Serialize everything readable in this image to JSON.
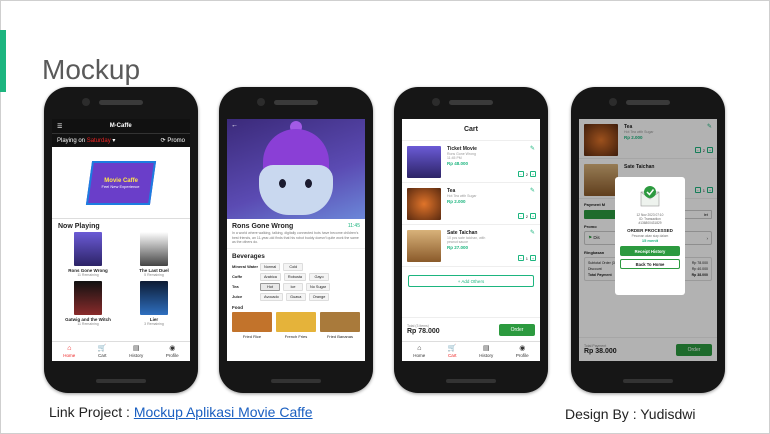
{
  "slide": {
    "title": "Mockup",
    "link_prefix": "Link Project :",
    "link_text": "Mockup Aplikasi Movie Caffe",
    "designer": "Design By : Yudisdwi",
    "accent_color": "#1db57f"
  },
  "home_screen": {
    "app_title": "M-Caffe",
    "playing_on": "Playing on",
    "day": "Saturday",
    "promo": "Promo",
    "banner_title": "Movie Caffe",
    "banner_subtitle": "Feel New Experience",
    "section_title": "Now Playing",
    "movies": [
      {
        "name": "Rons Gone Wrong",
        "remaining": "11 Remaining",
        "color": "#4b3f9a"
      },
      {
        "name": "The Last Duel",
        "remaining": "5 Remaining",
        "color": "#3b3b3b"
      },
      {
        "name": "Gatwig and the Witch",
        "remaining": "11 Remaining",
        "color": "#6b2a2a"
      },
      {
        "name": "Lier",
        "remaining": "3 Remaining",
        "color": "#1e3c6e"
      }
    ],
    "nav": [
      {
        "label": "Home",
        "icon": "home-icon"
      },
      {
        "label": "Cart",
        "icon": "cart-icon"
      },
      {
        "label": "History",
        "icon": "history-icon"
      },
      {
        "label": "Profile",
        "icon": "profile-icon"
      }
    ]
  },
  "detail_screen": {
    "movie_title": "Rons Gone Wrong",
    "time": "11:45",
    "description": "In a world where walking, talking, digitally connected bots have become children's best friends, an 11-year-old finds that his robot buddy doesn't quite work the same as the others do.",
    "section_title": "Beverages",
    "beverage_rows": [
      {
        "label": "Mineral Water",
        "options": [
          "Normal",
          "Cold"
        ]
      },
      {
        "label": "Coffe",
        "options": [
          "Arabica",
          "Robusta",
          "Gayo"
        ]
      },
      {
        "label": "Tea",
        "options": [
          "Hot",
          "Ice",
          "No Sugar"
        ]
      },
      {
        "label": "Juice",
        "options": [
          "Avocado",
          "Guava",
          "Orange"
        ]
      }
    ],
    "food_label": "Food",
    "foods": [
      {
        "name": "Fried Rice",
        "color": "#c2732b"
      },
      {
        "name": "French Fries",
        "color": "#e5b33a"
      },
      {
        "name": "Fried Bananas",
        "color": "#a97a3b"
      }
    ]
  },
  "cart_screen": {
    "title": "Cart",
    "items": [
      {
        "name": "Ticket Movie",
        "desc": "Rons Gone Wrong",
        "desc2": "11:45 PM",
        "price": "Rp 48.000",
        "qty": "2",
        "color": "#4b3f9a"
      },
      {
        "name": "Tea",
        "desc": "Hot Tea with Sugar",
        "desc2": "",
        "price": "Rp 2.000",
        "qty": "2",
        "color": "#b9501b"
      },
      {
        "name": "Sate Taichan",
        "desc": "10 pcs sate taichan, with",
        "desc2": "peanut sauce",
        "price": "Rp 27.000",
        "qty": "1",
        "color": "#c9a06a"
      }
    ],
    "add_others": "+ Add Others",
    "total_label": "Total (3 items)",
    "total": "Rp 78.000",
    "order_button": "Order",
    "nav": [
      "Home",
      "Cart",
      "History",
      "Profile"
    ]
  },
  "order_screen": {
    "top_item": {
      "name": "Tea",
      "desc": "Hot Tea with Sugar",
      "price": "Rp 2.000",
      "qty": "2"
    },
    "second_item": {
      "name": "Sate Taichan",
      "qty": "1"
    },
    "payment_label": "Payment M",
    "let_label": "let",
    "promo_label": "Promo",
    "promo_item": "Dis",
    "summary_title": "Ringkasan",
    "summary_rows": [
      {
        "label": "Subtotal Order (3 items)",
        "value": "Rp 78.000"
      },
      {
        "label": "Discount",
        "value": "Rp 40.000"
      },
      {
        "label": "Total Payment",
        "value": "Rp 38.000"
      }
    ],
    "total_label": "Total Payment",
    "total": "Rp 38.000",
    "order_button": "Order",
    "modal": {
      "date": "12 Nov 2023 07:10",
      "ref": "ID: Transaction",
      "code": "#136800431829",
      "title": "ORDER PROCESSED",
      "wait": "Pesanan akan siap dalam",
      "minutes": "15 menit",
      "history_button": "Receipt History",
      "home_button": "Back To Home"
    }
  }
}
